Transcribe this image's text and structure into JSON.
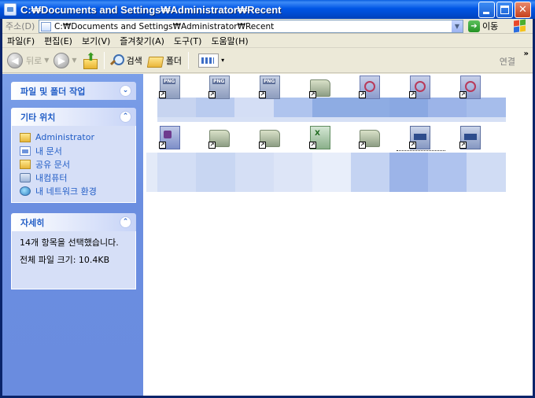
{
  "window": {
    "title": "C:₩Documents and Settings₩Administrator₩Recent"
  },
  "address": {
    "label": "주소(D)",
    "value": "C:₩Documents and Settings₩Administrator₩Recent",
    "go_label": "이동"
  },
  "menu": {
    "items": [
      "파일(F)",
      "편집(E)",
      "보기(V)",
      "즐겨찾기(A)",
      "도구(T)",
      "도움말(H)"
    ]
  },
  "toolbar": {
    "back_label": "뒤로",
    "search_label": "검색",
    "folders_label": "폴더",
    "links_label": "연결"
  },
  "taskpane": {
    "file_tasks_title": "파일 및 폴더 작업",
    "other_places_title": "기타 위치",
    "other_places": [
      {
        "label": "Administrator",
        "icon": "folder-icon"
      },
      {
        "label": "내 문서",
        "icon": "documents-icon"
      },
      {
        "label": "공유 문서",
        "icon": "folder-icon"
      },
      {
        "label": "내컴퓨터",
        "icon": "computer-icon"
      },
      {
        "label": "내 네트워크 환경",
        "icon": "network-icon"
      }
    ],
    "details_title": "자세히",
    "details_line1": "14개 항목을 선택했습니다.",
    "details_line2": "전체 파일 크기: 10.4KB"
  },
  "files": {
    "row1": [
      "png-shortcut",
      "png-shortcut",
      "png-shortcut",
      "folder-shortcut",
      "image-shortcut",
      "image-shortcut",
      "image-shortcut"
    ],
    "row2": [
      "document-shortcut",
      "folder-shortcut",
      "folder-shortcut",
      "excel-shortcut",
      "folder-shortcut",
      "pdf-shortcut",
      "pdf-shortcut"
    ]
  },
  "colors": {
    "titlebar": "#0055E5",
    "taskpane": "#6B8EE0",
    "panel_title": "#215DC6",
    "selection": "#9CB4E8"
  }
}
